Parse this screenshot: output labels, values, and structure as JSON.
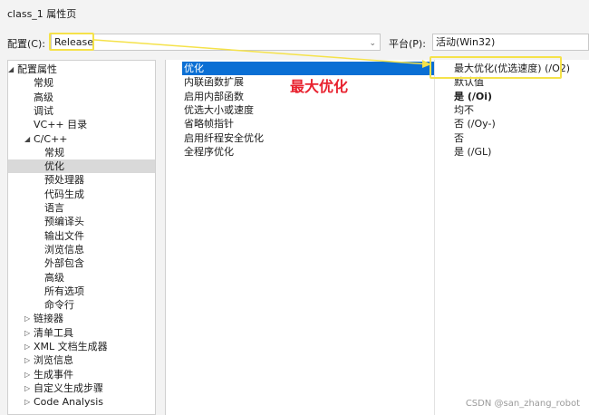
{
  "window": {
    "title": "class_1 属性页"
  },
  "header": {
    "config_label": "配置(C):",
    "config_value": "Release",
    "platform_label": "平台(P):",
    "platform_value": "活动(Win32)"
  },
  "tree": {
    "items": [
      {
        "label": "配置属性",
        "level": 0,
        "arrow": "◢"
      },
      {
        "label": "常规",
        "level": 1
      },
      {
        "label": "高级",
        "level": 1
      },
      {
        "label": "调试",
        "level": 1
      },
      {
        "label": "VC++ 目录",
        "level": 1
      },
      {
        "label": "C/C++",
        "level": 1,
        "arrow": "◢"
      },
      {
        "label": "常规",
        "level": 2
      },
      {
        "label": "优化",
        "level": 2,
        "selected": true
      },
      {
        "label": "预处理器",
        "level": 2
      },
      {
        "label": "代码生成",
        "level": 2
      },
      {
        "label": "语言",
        "level": 2
      },
      {
        "label": "预编译头",
        "level": 2
      },
      {
        "label": "输出文件",
        "level": 2
      },
      {
        "label": "浏览信息",
        "level": 2
      },
      {
        "label": "外部包含",
        "level": 2
      },
      {
        "label": "高级",
        "level": 2
      },
      {
        "label": "所有选项",
        "level": 2
      },
      {
        "label": "命令行",
        "level": 2
      },
      {
        "label": "链接器",
        "level": 1,
        "arrow": "▷"
      },
      {
        "label": "清单工具",
        "level": 1,
        "arrow": "▷"
      },
      {
        "label": "XML 文档生成器",
        "level": 1,
        "arrow": "▷"
      },
      {
        "label": "浏览信息",
        "level": 1,
        "arrow": "▷"
      },
      {
        "label": "生成事件",
        "level": 1,
        "arrow": "▷"
      },
      {
        "label": "自定义生成步骤",
        "level": 1,
        "arrow": "▷"
      },
      {
        "label": "Code Analysis",
        "level": 1,
        "arrow": "▷"
      }
    ]
  },
  "properties": [
    {
      "name": "优化",
      "value": "最大优化(优选速度) (/O2)",
      "selected": true
    },
    {
      "name": "内联函数扩展",
      "value": "默认值"
    },
    {
      "name": "启用内部函数",
      "value": "是 (/Oi)",
      "bold": true
    },
    {
      "name": "优选大小或速度",
      "value": "均不"
    },
    {
      "name": "省略帧指针",
      "value": "否 (/Oy-)"
    },
    {
      "name": "启用纤程安全优化",
      "value": "否"
    },
    {
      "name": "全程序优化",
      "value": "是 (/GL)"
    }
  ],
  "annotation": {
    "text": "最大优化",
    "color": "#e8222f"
  },
  "highlight_color": "#f5e24a",
  "selection_color": "#0a6fd4",
  "watermark": "CSDN @san_zhang_robot"
}
